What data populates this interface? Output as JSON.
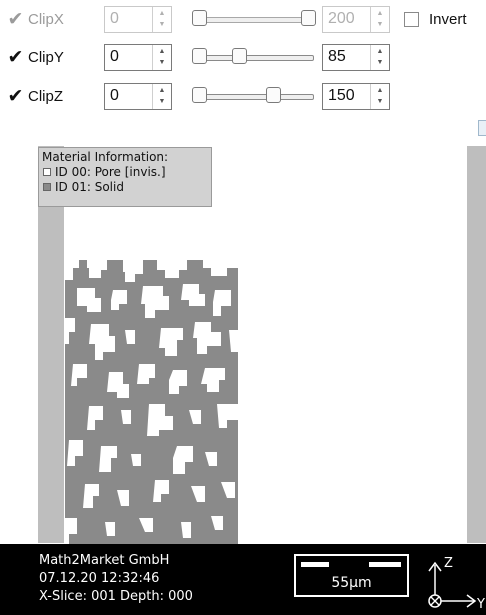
{
  "clip_controls": {
    "rows": [
      {
        "label": "ClipX",
        "checked": true,
        "enabled": false,
        "min_value": "0",
        "max_value": "200",
        "slider_min_fraction": 0.0,
        "slider_max_fraction": 1.0,
        "checkmark": "✔"
      },
      {
        "label": "ClipY",
        "checked": true,
        "enabled": true,
        "min_value": "0",
        "max_value": "85",
        "slider_min_fraction": 0.0,
        "slider_max_fraction": 0.425,
        "checkmark": "✔"
      },
      {
        "label": "ClipZ",
        "checked": true,
        "enabled": true,
        "min_value": "0",
        "max_value": "150",
        "slider_min_fraction": 0.0,
        "slider_max_fraction": 0.75,
        "checkmark": "✔"
      }
    ],
    "invert_label": "Invert",
    "invert_checked": false
  },
  "legend": {
    "title": "Material Information:",
    "items": [
      {
        "text": "ID 00: Pore [invis.]",
        "color": "#ffffff"
      },
      {
        "text": "ID 01: Solid",
        "color": "#8a8a8a"
      }
    ]
  },
  "footer": {
    "company": "Math2Market GmbH",
    "timestamp": "07.12.20 12:32:46",
    "slice_info": "X-Slice: 001 Depth: 000",
    "scale_label": "55μm",
    "axis_up": "Z",
    "axis_right": "Y"
  },
  "colors": {
    "solid": "#8a8a8a",
    "pore": "#ffffff",
    "domain_bar": "#bebebe",
    "footer_bg": "#000000"
  }
}
